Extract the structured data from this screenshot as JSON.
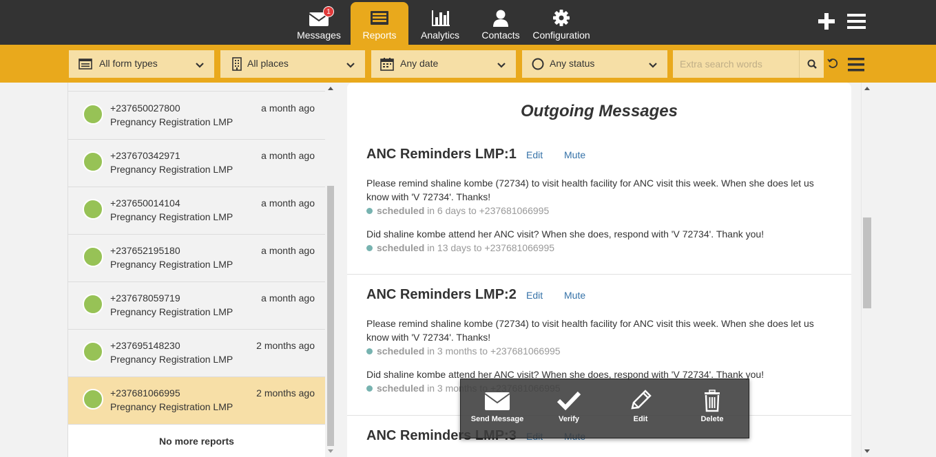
{
  "nav": {
    "tabs": [
      {
        "label": "Messages",
        "icon": "envelope-icon",
        "badge": "1"
      },
      {
        "label": "Reports",
        "icon": "reports-icon"
      },
      {
        "label": "Analytics",
        "icon": "bar-chart-icon"
      },
      {
        "label": "Contacts",
        "icon": "person-icon"
      },
      {
        "label": "Configuration",
        "icon": "gear-icon"
      }
    ],
    "active_tab": "Reports"
  },
  "filters": {
    "form_types": "All form types",
    "places": "All places",
    "date": "Any date",
    "status": "Any status",
    "search_placeholder": "Extra search words"
  },
  "reports": [
    {
      "phone": "+237650027800",
      "form": "Pregnancy Registration LMP",
      "when": "a month ago"
    },
    {
      "phone": "+237670342971",
      "form": "Pregnancy Registration LMP",
      "when": "a month ago"
    },
    {
      "phone": "+237650014104",
      "form": "Pregnancy Registration LMP",
      "when": "a month ago"
    },
    {
      "phone": "+237652195180",
      "form": "Pregnancy Registration LMP",
      "when": "a month ago"
    },
    {
      "phone": "+237678059719",
      "form": "Pregnancy Registration LMP",
      "when": "a month ago"
    },
    {
      "phone": "+237695148230",
      "form": "Pregnancy Registration LMP",
      "when": "2 months ago"
    },
    {
      "phone": "+237681066995",
      "form": "Pregnancy Registration LMP",
      "when": "2 months ago",
      "selected": true
    }
  ],
  "no_more": "No more reports",
  "detail": {
    "title": "Outgoing Messages",
    "edit_label": "Edit",
    "mute_label": "Mute",
    "tasks": [
      {
        "title": "ANC Reminders LMP:1",
        "messages": [
          {
            "text": "Please remind shaline kombe (72734) to visit health facility for ANC visit this week. When she does let us know with 'V 72734'. Thanks!",
            "state": "scheduled",
            "detail": "in 6 days to +237681066995"
          },
          {
            "text": "Did shaline kombe attend her ANC visit? When she does, respond with 'V 72734'. Thank you!",
            "state": "scheduled",
            "detail": "in 13 days to +237681066995"
          }
        ]
      },
      {
        "title": "ANC Reminders LMP:2",
        "messages": [
          {
            "text": "Please remind shaline kombe (72734) to visit health facility for ANC visit this week. When she does let us know with 'V 72734'. Thanks!",
            "state": "scheduled",
            "detail": "in 3 months to +237681066995"
          },
          {
            "text": "Did shaline kombe attend her ANC visit? When she does, respond with 'V 72734'. Thank you!",
            "state": "scheduled",
            "detail": "in 3 months to +237681066995"
          }
        ]
      },
      {
        "title": "ANC Reminders LMP:3",
        "messages": []
      }
    ]
  },
  "actions": [
    {
      "label": "Send Message",
      "icon": "envelope-icon"
    },
    {
      "label": "Verify",
      "icon": "checkmark-icon"
    },
    {
      "label": "Edit",
      "icon": "pencil-icon"
    },
    {
      "label": "Delete",
      "icon": "trash-icon"
    }
  ],
  "colors": {
    "topbar": "#333333",
    "accent": "#e9a91c",
    "filter_bg": "#f6dfa6",
    "selected_row": "#f7dfa7",
    "status_dot": "#97c256",
    "link": "#3572a8"
  }
}
